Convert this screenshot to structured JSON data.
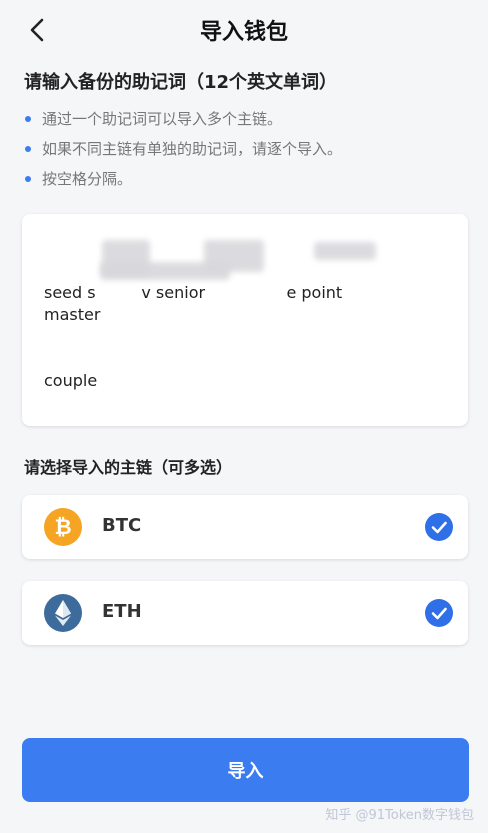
{
  "header": {
    "title": "导入钱包",
    "back_icon": "chevron-left-icon"
  },
  "mnemonic_section": {
    "title": "请输入备份的助记词（12个英文单词）",
    "tips": [
      "通过一个助记词可以导入多个主链。",
      "如果不同主链有单独的助记词，请逐个导入。",
      "按空格分隔。"
    ],
    "bullet_color": "#3b7cf0"
  },
  "mnemonic_input": {
    "line1": "seed s         v senior                e point             master",
    "line2": "couple                                         "
  },
  "chain_section": {
    "title": "请选择导入的主链（可多选）",
    "chains": [
      {
        "name": "BTC",
        "icon": "bitcoin-icon",
        "color": "#f5a523",
        "selected": true
      },
      {
        "name": "ETH",
        "icon": "ethereum-icon",
        "color": "#3d6b9b",
        "selected": true
      }
    ],
    "check_color": "#2f6fe8"
  },
  "import_button": {
    "label": "导入",
    "color": "#3b7cf0"
  },
  "watermark": "知乎 @91Token数字钱包"
}
